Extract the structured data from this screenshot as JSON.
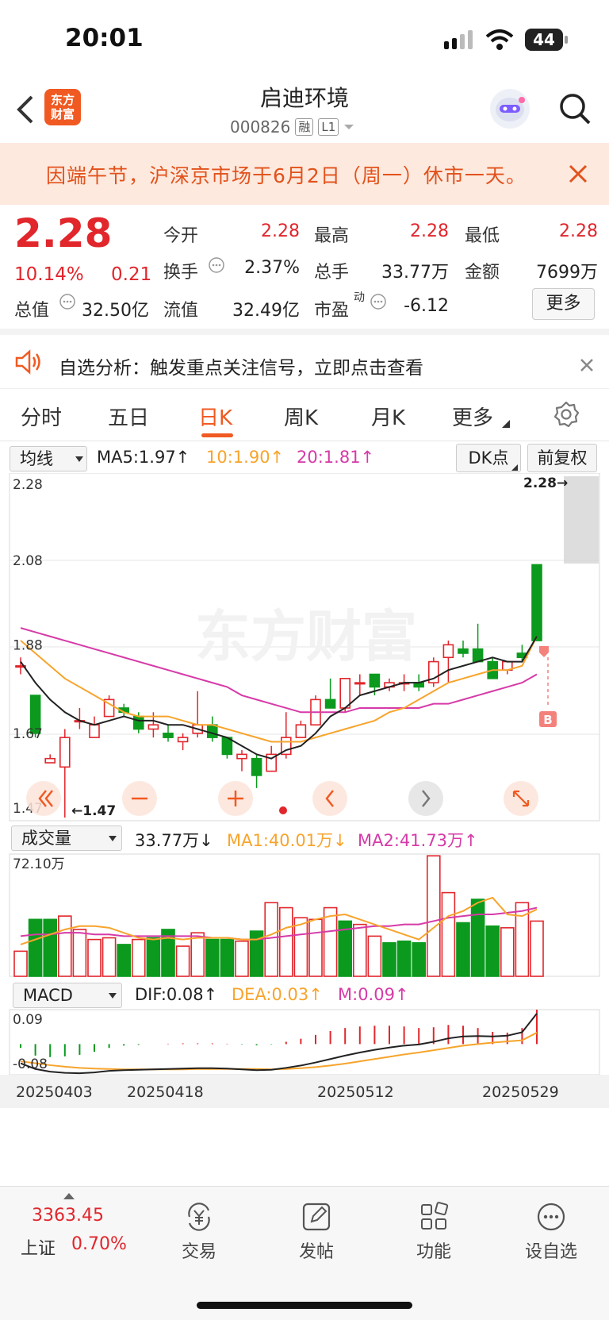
{
  "status_bar": {
    "time": "20:01",
    "battery": "44"
  },
  "header": {
    "logo_text": "东方财富",
    "title": "启迪环境",
    "code": "000826",
    "tag_rong": "融",
    "tag_level": "L1"
  },
  "notice": {
    "text": "因端午节，沪深京市场于6月2日（周一）休市一天。"
  },
  "quote": {
    "price": "2.28",
    "change_pct": "10.14%",
    "change_amt": "0.21",
    "open_label": "今开",
    "open": "2.28",
    "high_label": "最高",
    "high": "2.28",
    "low_label": "最低",
    "low": "2.28",
    "turnover_label": "换手",
    "turnover": "2.37%",
    "volume_label": "总手",
    "volume": "33.77万",
    "amount_label": "金额",
    "amount": "7699万",
    "mktcap_label": "总值",
    "mktcap": "32.50亿",
    "float_label": "流值",
    "float": "32.49亿",
    "pe_label": "市盈",
    "pe_sup": "动",
    "pe": "-6.12",
    "more_button": "更多"
  },
  "alert": {
    "text": "自选分析：触发重点关注信号，立即点击查看"
  },
  "tabs": [
    {
      "label": "分时"
    },
    {
      "label": "五日"
    },
    {
      "label": "日K",
      "active": true
    },
    {
      "label": "周K"
    },
    {
      "label": "月K"
    },
    {
      "label": "更多"
    }
  ],
  "chart_controls": {
    "ma_select": "均线",
    "ma5": "MA5:1.97↑",
    "ma10": "10:1.90↑",
    "ma20": "20:1.81↑",
    "dk_button": "DK点",
    "adjust_button": "前复权",
    "vol_select": "成交量",
    "vol_value": "33.77万↓",
    "vol_ma1": "MA1:40.01万↓",
    "vol_ma2": "MA2:41.73万↑",
    "macd_select": "MACD",
    "dif": "DIF:0.08↑",
    "dea": "DEA:0.03↑",
    "m": "M:0.09↑",
    "watermark": "东方财富",
    "price_last_label": "2.28→",
    "low_mark": "←1.47",
    "b_marker": "B"
  },
  "colors": {
    "up": "#e1262c",
    "down": "#0b9a1e",
    "ma5": "#222222",
    "ma10": "#f7a42c",
    "ma20": "#d63aa8",
    "brand": "#f05a22"
  },
  "chart_data": [
    {
      "type": "candlestick",
      "title": "",
      "y_ticks": [
        "2.28",
        "2.08",
        "1.88",
        "1.67",
        "1.47"
      ],
      "ylim": [
        1.47,
        2.28
      ],
      "x_ticks": [
        "20250403",
        "20250418",
        "20250512",
        "20250529"
      ],
      "ohlc": [
        [
          1.83,
          1.85,
          1.81,
          1.83
        ],
        [
          1.76,
          1.76,
          1.66,
          1.67
        ],
        [
          1.6,
          1.62,
          1.6,
          1.61
        ],
        [
          1.59,
          1.68,
          1.47,
          1.66
        ],
        [
          1.7,
          1.73,
          1.68,
          1.7
        ],
        [
          1.66,
          1.71,
          1.66,
          1.69
        ],
        [
          1.71,
          1.76,
          1.71,
          1.75
        ],
        [
          1.73,
          1.74,
          1.71,
          1.72
        ],
        [
          1.71,
          1.72,
          1.67,
          1.68
        ],
        [
          1.68,
          1.72,
          1.66,
          1.69
        ],
        [
          1.67,
          1.69,
          1.65,
          1.66
        ],
        [
          1.65,
          1.67,
          1.63,
          1.66
        ],
        [
          1.67,
          1.77,
          1.66,
          1.69
        ],
        [
          1.69,
          1.71,
          1.65,
          1.66
        ],
        [
          1.66,
          1.66,
          1.61,
          1.62
        ],
        [
          1.61,
          1.63,
          1.58,
          1.62
        ],
        [
          1.61,
          1.62,
          1.54,
          1.57
        ],
        [
          1.58,
          1.64,
          1.58,
          1.62
        ],
        [
          1.62,
          1.72,
          1.61,
          1.66
        ],
        [
          1.66,
          1.7,
          1.66,
          1.69
        ],
        [
          1.69,
          1.76,
          1.69,
          1.75
        ],
        [
          1.75,
          1.8,
          1.73,
          1.73
        ],
        [
          1.73,
          1.8,
          1.72,
          1.8
        ],
        [
          1.79,
          1.81,
          1.76,
          1.79
        ],
        [
          1.81,
          1.81,
          1.76,
          1.78
        ],
        [
          1.78,
          1.8,
          1.77,
          1.79
        ],
        [
          1.79,
          1.81,
          1.77,
          1.79
        ],
        [
          1.79,
          1.81,
          1.77,
          1.78
        ],
        [
          1.79,
          1.85,
          1.78,
          1.84
        ],
        [
          1.85,
          1.89,
          1.79,
          1.88
        ],
        [
          1.87,
          1.89,
          1.85,
          1.86
        ],
        [
          1.87,
          1.93,
          1.84,
          1.84
        ],
        [
          1.84,
          1.85,
          1.8,
          1.8
        ],
        [
          1.82,
          1.84,
          1.81,
          1.84
        ],
        [
          1.86,
          1.88,
          1.84,
          1.85
        ],
        [
          2.07,
          2.07,
          1.89,
          1.89
        ]
      ],
      "ma5": [
        1.84,
        1.79,
        1.75,
        1.72,
        1.7,
        1.69,
        1.7,
        1.71,
        1.7,
        1.7,
        1.69,
        1.69,
        1.68,
        1.67,
        1.66,
        1.64,
        1.62,
        1.61,
        1.63,
        1.64,
        1.67,
        1.71,
        1.73,
        1.76,
        1.77,
        1.78,
        1.79,
        1.79,
        1.8,
        1.82,
        1.83,
        1.84,
        1.85,
        1.84,
        1.84,
        1.9
      ],
      "ma10": [
        1.89,
        1.86,
        1.83,
        1.8,
        1.78,
        1.76,
        1.74,
        1.72,
        1.71,
        1.71,
        1.71,
        1.7,
        1.69,
        1.69,
        1.68,
        1.67,
        1.66,
        1.65,
        1.65,
        1.65,
        1.66,
        1.67,
        1.68,
        1.69,
        1.7,
        1.72,
        1.73,
        1.75,
        1.77,
        1.79,
        1.8,
        1.81,
        1.82,
        1.82,
        1.83,
        1.9
      ],
      "ma20": [
        1.92,
        1.91,
        1.9,
        1.89,
        1.88,
        1.87,
        1.86,
        1.85,
        1.84,
        1.83,
        1.82,
        1.81,
        1.8,
        1.79,
        1.78,
        1.76,
        1.75,
        1.74,
        1.73,
        1.72,
        1.72,
        1.72,
        1.72,
        1.73,
        1.73,
        1.73,
        1.73,
        1.73,
        1.74,
        1.74,
        1.75,
        1.76,
        1.77,
        1.78,
        1.79,
        1.81
      ]
    },
    {
      "type": "bar",
      "title": "成交量",
      "y_ticks": [
        "72.10万"
      ],
      "ylim": [
        0,
        72.1
      ],
      "values": [
        15,
        34,
        34,
        36,
        28,
        22,
        23,
        19,
        22,
        23,
        28,
        18,
        26,
        22,
        22,
        21,
        27,
        44,
        41,
        35,
        34,
        41,
        33,
        31,
        24,
        20,
        21,
        20,
        72,
        50,
        32,
        46,
        30,
        29,
        44,
        33
      ],
      "up": [
        1,
        0,
        0,
        1,
        1,
        1,
        1,
        0,
        1,
        0,
        0,
        1,
        1,
        0,
        0,
        1,
        0,
        1,
        1,
        1,
        1,
        1,
        0,
        1,
        1,
        0,
        0,
        0,
        1,
        1,
        0,
        0,
        0,
        1,
        1,
        1
      ],
      "ma1": [
        19,
        22,
        25,
        28,
        30,
        30,
        29,
        26,
        23,
        22,
        23,
        22,
        23,
        23,
        23,
        22,
        22,
        25,
        29,
        31,
        34,
        36,
        37,
        34,
        31,
        28,
        25,
        22,
        29,
        36,
        39,
        44,
        47,
        37,
        36,
        40
      ],
      "ma2": [
        24,
        25,
        25,
        26,
        26,
        25,
        25,
        24,
        24,
        24,
        24,
        24,
        24,
        23,
        23,
        22,
        22,
        23,
        24,
        25,
        26,
        27,
        28,
        29,
        30,
        30,
        31,
        31,
        33,
        35,
        36,
        37,
        37,
        38,
        39,
        41
      ]
    },
    {
      "type": "line",
      "title": "MACD",
      "y_ticks": [
        "0.09",
        "-0.08"
      ],
      "ylim": [
        -0.08,
        0.09
      ],
      "dif": [
        -0.05,
        -0.065,
        -0.072,
        -0.075,
        -0.076,
        -0.074,
        -0.07,
        -0.068,
        -0.067,
        -0.066,
        -0.065,
        -0.064,
        -0.063,
        -0.063,
        -0.064,
        -0.066,
        -0.068,
        -0.067,
        -0.062,
        -0.056,
        -0.048,
        -0.039,
        -0.03,
        -0.022,
        -0.015,
        -0.009,
        -0.004,
        -0.001,
        0.006,
        0.015,
        0.02,
        0.021,
        0.02,
        0.022,
        0.031,
        0.08
      ],
      "dea": [
        -0.045,
        -0.05,
        -0.055,
        -0.059,
        -0.062,
        -0.064,
        -0.065,
        -0.066,
        -0.066,
        -0.066,
        -0.066,
        -0.066,
        -0.065,
        -0.065,
        -0.065,
        -0.065,
        -0.065,
        -0.066,
        -0.065,
        -0.063,
        -0.06,
        -0.056,
        -0.051,
        -0.045,
        -0.039,
        -0.033,
        -0.027,
        -0.022,
        -0.016,
        -0.01,
        -0.004,
        0.0,
        0.004,
        0.007,
        0.01,
        0.03
      ],
      "hist": [
        -0.01,
        -0.03,
        -0.034,
        -0.032,
        -0.028,
        -0.02,
        -0.01,
        -0.004,
        -0.002,
        0.0,
        0.001,
        0.002,
        0.002,
        0.002,
        0.001,
        -0.001,
        -0.003,
        -0.001,
        0.006,
        0.014,
        0.024,
        0.034,
        0.042,
        0.046,
        0.048,
        0.048,
        0.046,
        0.042,
        0.044,
        0.05,
        0.048,
        0.042,
        0.032,
        0.03,
        0.042,
        0.09
      ]
    }
  ],
  "bottom_nav": {
    "index_value": "3363.45",
    "index_name": "上证",
    "index_pct": "0.70%",
    "trade": "交易",
    "post": "发帖",
    "functions": "功能",
    "watchlist": "设自选"
  }
}
